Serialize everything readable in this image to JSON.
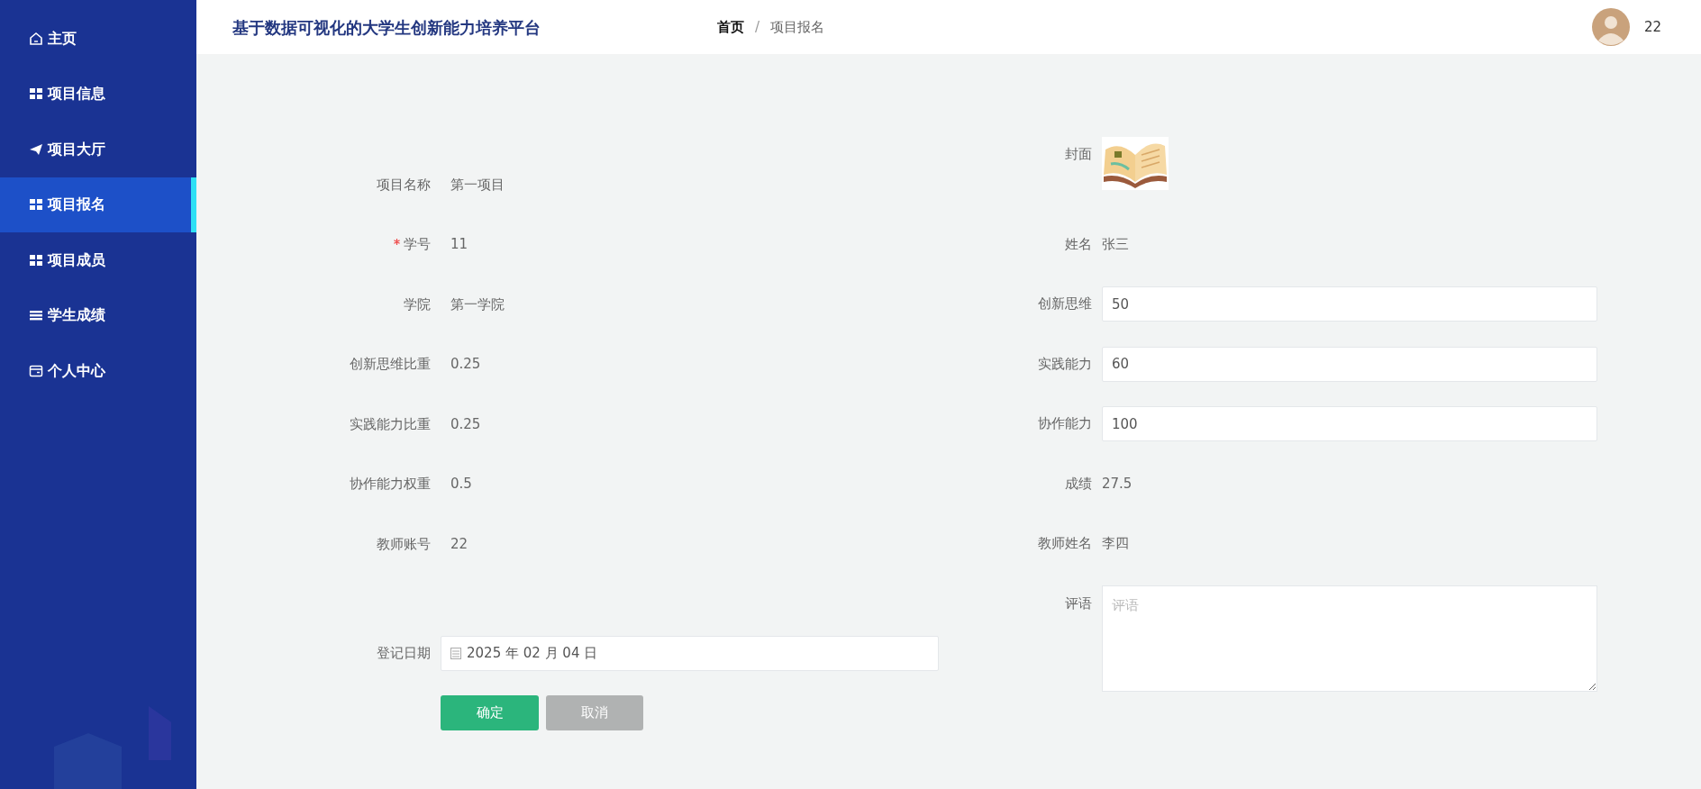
{
  "header": {
    "title": "基于数据可视化的大学生创新能力培养平台",
    "breadcrumb": [
      {
        "label": "首页",
        "current": false
      },
      {
        "label": "项目报名",
        "current": true
      }
    ],
    "breadcrumb_separator": "/",
    "user": {
      "name": "22"
    }
  },
  "sidebar": {
    "items": [
      {
        "label": "主页",
        "kind": "home",
        "selected": false
      },
      {
        "label": "项目信息",
        "kind": "grid",
        "selected": false
      },
      {
        "label": "项目大厅",
        "kind": "send",
        "selected": false
      },
      {
        "label": "项目报名",
        "kind": "grid",
        "selected": true
      },
      {
        "label": "项目成员",
        "kind": "grid",
        "selected": false
      },
      {
        "label": "学生成绩",
        "kind": "list",
        "selected": false
      },
      {
        "label": "个人中心",
        "kind": "card",
        "selected": false
      }
    ]
  },
  "form": {
    "left": [
      {
        "kind": "text",
        "label": "项目名称",
        "value": "第一项目",
        "required": false
      },
      {
        "kind": "text",
        "label": "学号",
        "value": "11",
        "required": true
      },
      {
        "kind": "text",
        "label": "学院",
        "value": "第一学院",
        "required": false
      },
      {
        "kind": "text",
        "label": "创新思维比重",
        "value": "0.25",
        "required": false
      },
      {
        "kind": "text",
        "label": "实践能力比重",
        "value": "0.25",
        "required": false
      },
      {
        "kind": "text",
        "label": "协作能力权重",
        "value": "0.5",
        "required": false
      },
      {
        "kind": "text",
        "label": "教师账号",
        "value": "22",
        "required": false
      },
      {
        "kind": "date",
        "label": "登记日期",
        "value": "2025 年 02 月 04 日",
        "required": false
      }
    ],
    "right": [
      {
        "label": "封面",
        "required": false
      },
      {
        "kind": "text",
        "label": "姓名",
        "value": "张三",
        "required": false
      },
      {
        "kind": "input",
        "label": "创新思维",
        "value": "50",
        "required": false
      },
      {
        "kind": "input",
        "label": "实践能力",
        "value": "60",
        "required": false
      },
      {
        "kind": "input",
        "label": "协作能力",
        "value": "100",
        "required": false
      },
      {
        "kind": "text",
        "label": "成绩",
        "value": "27.5",
        "required": false
      },
      {
        "kind": "text",
        "label": "教师姓名",
        "value": "李四",
        "required": false
      },
      {
        "kind": "textarea",
        "label": "评语",
        "placeholder": "评语",
        "required": false
      }
    ]
  },
  "buttons": [
    {
      "label": "确定",
      "kind": "primary"
    },
    {
      "label": "取消",
      "kind": "secondary"
    }
  ]
}
